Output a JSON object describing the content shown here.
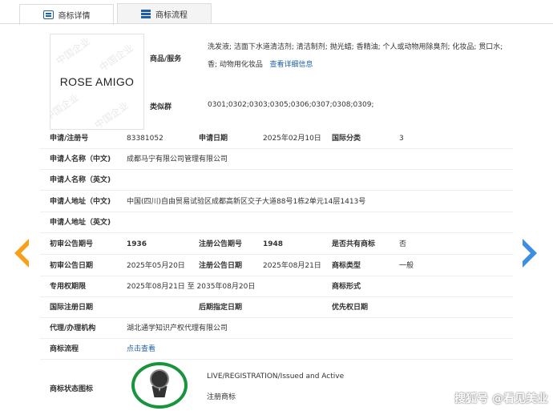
{
  "tabs": [
    {
      "label": "商标详情",
      "icon": "document-list-icon",
      "active": true
    },
    {
      "label": "商标流程",
      "icon": "table-grid-icon",
      "active": false
    }
  ],
  "logo": {
    "mark_text": "ROSE AMIGO",
    "watermark": "中国企业"
  },
  "goods": {
    "label": "商品/服务",
    "text": "洗发液; 洁面下水道清洁剂; 清洁制剂; 抛光蜡; 香精油; 个人或动物用除臭剂; 化妆品; 贯口水; 香; 动物用化妆品",
    "link": "查看详细信息"
  },
  "similar": {
    "label": "类似群",
    "value": "0301;0302;0303;0305;0306;0307;0308;0309;"
  },
  "fields": {
    "reg_no": {
      "label": "申请/注册号",
      "value": "83381052"
    },
    "apply_date": {
      "label": "申请日期",
      "value": "2025年02月10日"
    },
    "intl_class": {
      "label": "国际分类",
      "value": "3"
    },
    "applicant_cn": {
      "label": "申请人名称（中文)",
      "value": "成都马宁有限公司管理有限公司"
    },
    "applicant_en": {
      "label": "申请人名称（英文)",
      "value": ""
    },
    "address_cn": {
      "label": "申请人地址（中文)",
      "value": "中国(四川)自由贸易试验区成都高新区交子大道88号1栋2单元14层1413号"
    },
    "address_en": {
      "label": "申请人地址（英文)",
      "value": ""
    },
    "prelim_no": {
      "label": "初审公告期号",
      "value": "1936"
    },
    "reg_pub_no": {
      "label": "注册公告期号",
      "value": "1948"
    },
    "shared": {
      "label": "是否共有商标",
      "value": "否"
    },
    "prelim_date": {
      "label": "初审公告日期",
      "value": "2025年05月20日"
    },
    "reg_pub_date": {
      "label": "注册公告日期",
      "value": "2025年08月21日"
    },
    "mark_type": {
      "label": "商标类型",
      "value": "一般"
    },
    "exclusive_period": {
      "label": "专用权期限",
      "value": "2025年08月21日 至 2035年08月20日"
    },
    "mark_form": {
      "label": "商标形式",
      "value": ""
    },
    "intl_reg_date": {
      "label": "国际注册日期",
      "value": ""
    },
    "later_date": {
      "label": "后期指定日期",
      "value": ""
    },
    "priority_date": {
      "label": "优先权日期",
      "value": ""
    },
    "agent": {
      "label": "代理/办理机构",
      "value": "湖北通学知识产权代理有限公司"
    },
    "flow": {
      "label": "商标流程",
      "value": "点击查看"
    },
    "status_icon": {
      "label": "商标状态图标",
      "value": ""
    }
  },
  "status": {
    "line1": "LIVE/REGISTRATION/Issued and Active",
    "line2": "注册商标",
    "icon": "registered-seal-icon"
  },
  "nav": {
    "prev": "chevron-left-icon",
    "next": "chevron-right-icon"
  },
  "watermark": "搜狐号 @看见美业",
  "colors": {
    "link": "#1f5faa",
    "prev_arrow": "#f5a11c",
    "next_arrow": "#3d8ee0",
    "seal_ring": "#18943c"
  }
}
